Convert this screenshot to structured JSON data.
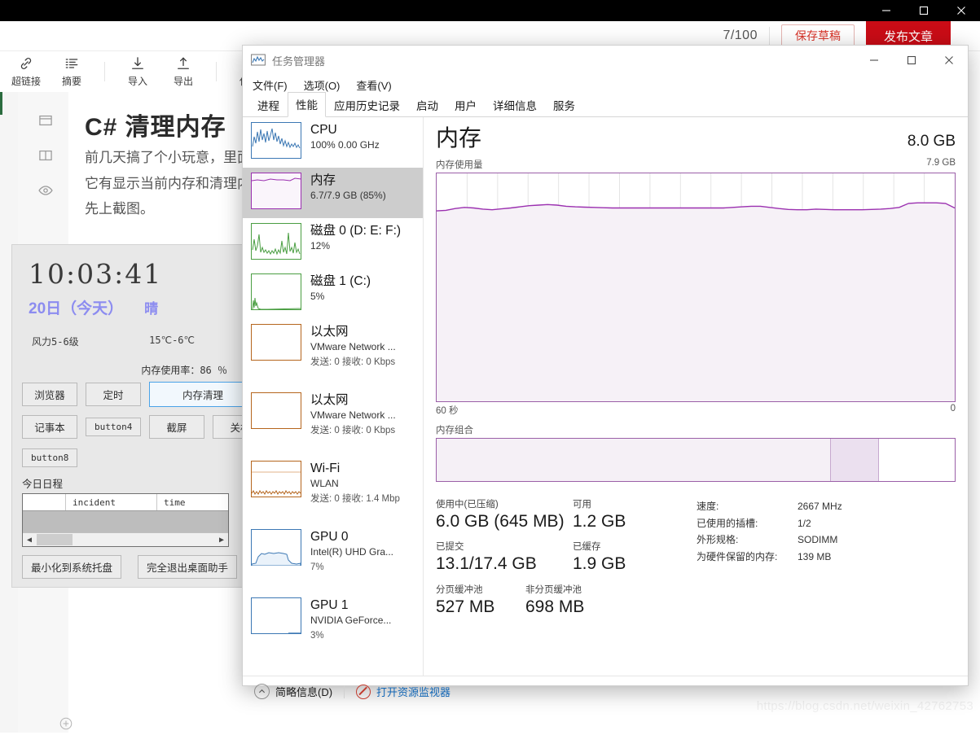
{
  "background_window": {
    "titlebar_buttons": [
      "minimize-icon",
      "maximize-icon",
      "close-icon"
    ],
    "editor": {
      "word_count": "7/100",
      "save_draft_label": "保存草稿",
      "publish_label": "发布文章",
      "toolbar": [
        {
          "label": "超链接",
          "icon": "link-icon"
        },
        {
          "label": "摘要",
          "icon": "summary-icon"
        },
        {
          "label": "导入",
          "icon": "import-icon"
        },
        {
          "label": "导出",
          "icon": "export-icon"
        },
        {
          "label": "保存",
          "icon": "save-icon"
        }
      ],
      "doc_title": "C# 清理内存",
      "doc_paragraphs": [
        "前几天搞了个小玩意，里面",
        "它有显示当前内存和清理内",
        "先上截图。"
      ]
    },
    "watermark": "https://blog.csdn.net/weixin_42762753"
  },
  "widget": {
    "clock": "10:03:41",
    "date": "20日（今天）",
    "weather": "晴",
    "wind": "风力5-6级",
    "temperature": "15℃-6℃",
    "memory_rate_label": "内存使用率：86 ％",
    "buttons_row1": [
      "浏览器",
      "定时"
    ],
    "button_primary": "内存清理",
    "buttons_row2": [
      "记事本",
      "button4",
      "截屏",
      "关机"
    ],
    "buttons_row3": [
      "button8"
    ],
    "schedule_label": "今日日程",
    "schedule_columns": [
      "",
      "incident",
      "time"
    ],
    "schedule_rows": [],
    "footer_buttons": [
      "最小化到系统托盘",
      "完全退出桌面助手"
    ]
  },
  "taskmanager": {
    "window_title": "任务管理器",
    "app_icon": "taskmanager-icon",
    "window_buttons": [
      "minimize-icon",
      "maximize-icon",
      "close-icon"
    ],
    "menus": [
      "文件(F)",
      "选项(O)",
      "查看(V)"
    ],
    "tabs": [
      {
        "label": "进程",
        "active": false
      },
      {
        "label": "性能",
        "active": true
      },
      {
        "label": "应用历史记录",
        "active": false
      },
      {
        "label": "启动",
        "active": false
      },
      {
        "label": "用户",
        "active": false
      },
      {
        "label": "详细信息",
        "active": false
      },
      {
        "label": "服务",
        "active": false
      }
    ],
    "sidebar": [
      {
        "name": "CPU",
        "sub": "100% 0.00 GHz",
        "sub2": "",
        "color": "#3c78b4",
        "selected": false
      },
      {
        "name": "内存",
        "sub": "6.7/7.9 GB (85%)",
        "sub2": "",
        "color": "#9b30b0",
        "selected": true
      },
      {
        "name": "磁盘 0 (D: E: F:)",
        "sub": "12%",
        "sub2": "",
        "color": "#4a9e42",
        "selected": false
      },
      {
        "name": "磁盘 1 (C:)",
        "sub": "5%",
        "sub2": "",
        "color": "#4a9e42",
        "selected": false
      },
      {
        "name": "以太网",
        "sub": "VMware Network ...",
        "sub2": "发送: 0 接收: 0 Kbps",
        "color": "#b5651d",
        "selected": false
      },
      {
        "name": "以太网",
        "sub": "VMware Network ...",
        "sub2": "发送: 0 接收: 0 Kbps",
        "color": "#b5651d",
        "selected": false
      },
      {
        "name": "Wi-Fi",
        "sub": "WLAN",
        "sub2": "发送: 0 接收: 1.4 Mbp",
        "color": "#b5651d",
        "selected": false
      },
      {
        "name": "GPU 0",
        "sub": "Intel(R) UHD Gra...",
        "sub2": "7%",
        "color": "#3c78b4",
        "selected": false
      },
      {
        "name": "GPU 1",
        "sub": "NVIDIA GeForce...",
        "sub2": "3%",
        "color": "#3c78b4",
        "selected": false
      }
    ],
    "main": {
      "heading": "内存",
      "heading_right": "8.0 GB",
      "graph_label": "内存使用量",
      "graph_max": "7.9 GB",
      "axis_left": "60 秒",
      "axis_right": "0",
      "composition_label": "内存组合",
      "accent_color": "#9b5fa8",
      "stats": [
        {
          "label": "使用中(已压缩)",
          "value": "6.0 GB (645 MB)"
        },
        {
          "label": "可用",
          "value": "1.2 GB"
        },
        {
          "label": "已提交",
          "value": "13.1/17.4 GB"
        },
        {
          "label": "已缓存",
          "value": "1.9 GB"
        },
        {
          "label": "分页缓冲池",
          "value": "527 MB"
        },
        {
          "label": "非分页缓冲池",
          "value": "698 MB"
        }
      ],
      "specs": [
        {
          "label": "速度:",
          "value": "2667 MHz"
        },
        {
          "label": "已使用的插槽:",
          "value": "1/2"
        },
        {
          "label": "外形规格:",
          "value": "SODIMM"
        },
        {
          "label": "为硬件保留的内存:",
          "value": "139 MB"
        }
      ]
    },
    "footer": {
      "collapse_label": "简略信息(D)",
      "resource_monitor_label": "打开资源监视器"
    },
    "chart_data": {
      "type": "line",
      "title": "内存使用量",
      "ylabel": "",
      "xlabel": "60 秒",
      "ylim": [
        0,
        7.9
      ],
      "xlim": [
        60,
        0
      ],
      "grid": true,
      "legend": "none",
      "series": [
        {
          "name": "内存使用量 (GB)",
          "values": [
            6.6,
            6.62,
            6.68,
            6.72,
            6.7,
            6.66,
            6.64,
            6.67,
            6.7,
            6.74,
            6.78,
            6.8,
            6.82,
            6.8,
            6.76,
            6.74,
            6.73,
            6.72,
            6.71,
            6.7,
            6.7,
            6.7,
            6.7,
            6.7,
            6.7,
            6.7,
            6.7,
            6.7,
            6.7,
            6.7,
            6.7,
            6.7,
            6.72,
            6.74,
            6.76,
            6.76,
            6.72,
            6.68,
            6.65,
            6.64,
            6.64,
            6.66,
            6.65,
            6.64,
            6.64,
            6.64,
            6.64,
            6.65,
            6.66,
            6.68,
            6.72,
            6.86,
            6.88,
            6.88,
            6.88,
            6.86,
            6.7
          ]
        }
      ]
    }
  }
}
